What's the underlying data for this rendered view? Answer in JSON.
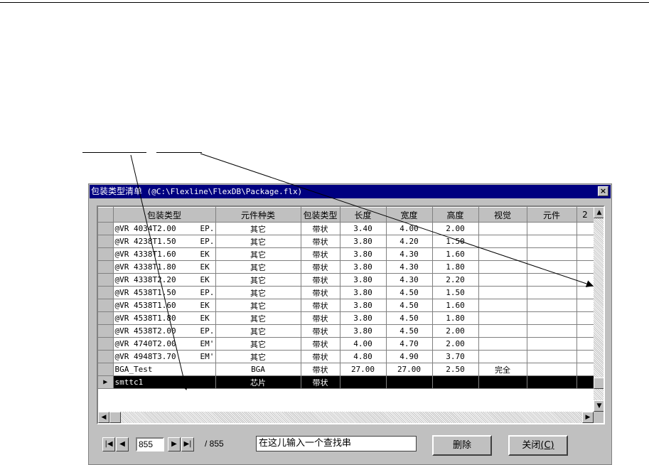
{
  "window": {
    "title_cn": "包装类型清单",
    "title_path": " (@C:\\Flexline\\FlexDB\\Package.flx)",
    "close_label": "×"
  },
  "grid": {
    "headers": [
      "包装类型",
      "元件种类",
      "包装类型",
      "长度",
      "宽度",
      "高度",
      "视觉",
      "元件",
      "2"
    ],
    "rows": [
      [
        "@VR 4034T2.00",
        "EP.",
        "其它",
        "带状",
        "3.40",
        "4.00",
        "2.00",
        "",
        ""
      ],
      [
        "@VR 4238T1.50",
        "EP.",
        "其它",
        "带状",
        "3.80",
        "4.20",
        "1.50",
        "",
        ""
      ],
      [
        "@VR 4338T1.60",
        "EK",
        "其它",
        "带状",
        "3.80",
        "4.30",
        "1.60",
        "",
        ""
      ],
      [
        "@VR 4338T1.80",
        "EK",
        "其它",
        "带状",
        "3.80",
        "4.30",
        "1.80",
        "",
        ""
      ],
      [
        "@VR 4338T2.20",
        "EK",
        "其它",
        "带状",
        "3.80",
        "4.30",
        "2.20",
        "",
        ""
      ],
      [
        "@VR 4538T1.50",
        "EP.",
        "其它",
        "带状",
        "3.80",
        "4.50",
        "1.50",
        "",
        ""
      ],
      [
        "@VR 4538T1.60",
        "EK",
        "其它",
        "带状",
        "3.80",
        "4.50",
        "1.60",
        "",
        ""
      ],
      [
        "@VR 4538T1.80",
        "EK",
        "其它",
        "带状",
        "3.80",
        "4.50",
        "1.80",
        "",
        ""
      ],
      [
        "@VR 4538T2.00",
        "EP.",
        "其它",
        "带状",
        "3.80",
        "4.50",
        "2.00",
        "",
        ""
      ],
      [
        "@VR 4740T2.00",
        "EM'",
        "其它",
        "带状",
        "4.00",
        "4.70",
        "2.00",
        "",
        ""
      ],
      [
        "@VR 4948T3.70",
        "EM'",
        "其它",
        "带状",
        "4.80",
        "4.90",
        "3.70",
        "",
        ""
      ],
      [
        "BGA_Test",
        "",
        "BGA",
        "带状",
        "27.00",
        "27.00",
        "2.50",
        "完全",
        ""
      ],
      [
        "smttc1",
        "",
        "芯片",
        "带状",
        "",
        "",
        "",
        "",
        ""
      ]
    ],
    "selected_row": 12,
    "current_marker": "▶"
  },
  "nav": {
    "first": "|◀",
    "prev": "◀",
    "current": "855",
    "next": "▶",
    "last": "▶|",
    "total": "/ 855"
  },
  "search": {
    "value": "在这儿输入一个查找串"
  },
  "buttons": {
    "delete": "删除",
    "close": "关闭",
    "close_key": "(C)"
  },
  "scroll": {
    "up": "▲",
    "down": "▼",
    "left": "◀",
    "right": "▶"
  }
}
